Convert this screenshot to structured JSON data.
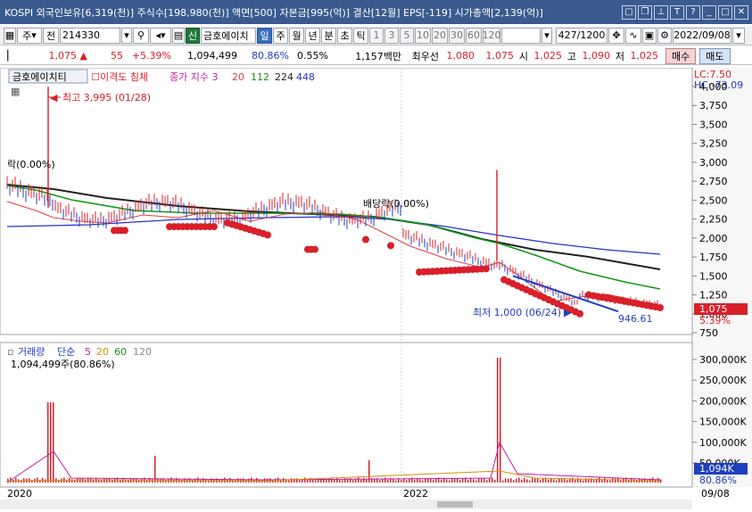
{
  "title_text": "KOSPI 외국인보유[6,319(천)] 주식수[198,980(천)] 액면[500] 자본금[995(억)] 결산[12월] EPS[-119] 시가총액[2,139(억)]",
  "toolbar": {
    "market": "주",
    "type": "전",
    "code": "214330",
    "badge": "신",
    "stock_name": "금호에이치",
    "periods": [
      "일",
      "주",
      "월",
      "년",
      "분",
      "초",
      "틱"
    ],
    "intervals": [
      "1",
      "3",
      "5",
      "10",
      "20",
      "30",
      "60",
      "120"
    ],
    "count": "427",
    "count_total": "/1200",
    "date": "2022/09/08"
  },
  "quote": {
    "price": "1,075",
    "change": "55",
    "change_pct": "+5.39%",
    "volume": "1,094,499",
    "vol_ratio": "80.86%",
    "turnover": "0.55%",
    "amount": "1,157백만",
    "best_sell_label": "최우선",
    "best_sell": "1,080",
    "best_buy": "1,075",
    "open_label": "시",
    "open": "1,025",
    "high_label": "고",
    "high": "1,090",
    "low_label": "저",
    "low": "1,025",
    "buy_btn": "매수",
    "sell_btn": "매도"
  },
  "price_panel": {
    "name_tab": "금호에이치티",
    "indicator1": "이격도 침체",
    "indicator2": "종가 지수 3",
    "ma_labels": [
      "20",
      "112",
      "224",
      "448"
    ],
    "lc": "LC:7.50",
    "hc": "HC:-73.09",
    "high_note": "최고 3,995 (01/28)",
    "low_note": "최저 1,000 (06/24)",
    "ex_div_left": "락(0.00%)",
    "ex_div_mid": "배당락(0.00%)",
    "trend_label": "946.61",
    "right_price": "1,075",
    "right_pct": "5.39%",
    "y_ticks": [
      "4,000",
      "3,750",
      "3,500",
      "3,250",
      "3,000",
      "2,750",
      "2,500",
      "2,250",
      "2,000",
      "1,750",
      "1,500",
      "1,250",
      "1,000",
      "750"
    ]
  },
  "volume_panel": {
    "label": "거래량",
    "type": "단순",
    "ma_labels": [
      "5",
      "20",
      "60",
      "120"
    ],
    "value": "1,094,499주(80.86%)",
    "y_ticks": [
      "300,000K",
      "250,000K",
      "200,000K",
      "150,000K",
      "100,000K",
      "50,000K"
    ],
    "right_value": "1,094K",
    "right_pct": "80.86%"
  },
  "x_axis": {
    "labels": [
      "2020",
      "2022"
    ],
    "right_date": "09/08"
  },
  "colors": {
    "up": "#d8202a",
    "down": "#1f3fbf",
    "ma20": "#e04040",
    "ma112": "#119911",
    "ma224": "#222222",
    "ma448": "#2233cc",
    "title_bg": "#3b5a8f"
  }
}
